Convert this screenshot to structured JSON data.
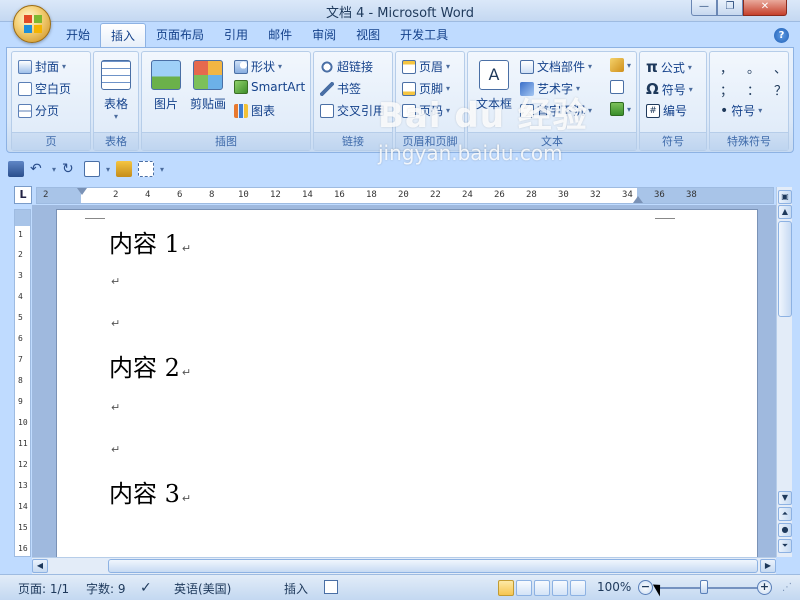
{
  "window": {
    "title": "文档 4 - Microsoft Word"
  },
  "tabs": [
    {
      "label": "开始"
    },
    {
      "label": "插入",
      "active": true
    },
    {
      "label": "页面布局"
    },
    {
      "label": "引用"
    },
    {
      "label": "邮件"
    },
    {
      "label": "审阅"
    },
    {
      "label": "视图"
    },
    {
      "label": "开发工具"
    }
  ],
  "ribbon": {
    "pages": {
      "label": "页",
      "cover": "封面",
      "blank": "空白页",
      "break": "分页"
    },
    "tables": {
      "label": "表格",
      "table": "表格"
    },
    "illustrations": {
      "label": "插图",
      "picture": "图片",
      "clipart": "剪贴画",
      "shapes": "形状",
      "smartart": "SmartArt",
      "chart": "图表"
    },
    "links": {
      "label": "链接",
      "hyperlink": "超链接",
      "bookmark": "书签",
      "crossref": "交叉引用"
    },
    "header_footer": {
      "label": "页眉和页脚",
      "header": "页眉",
      "footer": "页脚",
      "pagenum": "页码"
    },
    "text": {
      "label": "文本",
      "textbox": "文本框",
      "quickparts": "文档部件",
      "wordart": "艺术字",
      "dropcap": "首字下沉"
    },
    "symbols": {
      "label": "符号",
      "equation": "公式",
      "symbol": "符号",
      "number": "编号"
    },
    "special": {
      "label": "特殊符号",
      "row1": [
        "，",
        "。",
        "、"
      ],
      "row2": [
        "；",
        "：",
        "？"
      ],
      "symbol": "符号"
    }
  },
  "document": {
    "paragraphs": [
      {
        "text": "内容 1",
        "heading": true
      },
      {
        "text": "",
        "heading": false
      },
      {
        "text": "",
        "heading": false
      },
      {
        "text": "内容 2",
        "heading": true
      },
      {
        "text": "",
        "heading": false
      },
      {
        "text": "",
        "heading": false
      },
      {
        "text": "内容 3",
        "heading": true
      }
    ],
    "paragraph_mark": "↵"
  },
  "ruler": {
    "horizontal_ticks": [
      "2",
      "",
      "2",
      "4",
      "6",
      "8",
      "10",
      "12",
      "14",
      "16",
      "18",
      "20",
      "22",
      "24",
      "26",
      "28",
      "30",
      "32",
      "34",
      "36",
      "38"
    ],
    "vertical_ticks": [
      "1",
      "1",
      "2",
      "3",
      "4",
      "5",
      "6",
      "7",
      "8",
      "9",
      "10",
      "11",
      "12",
      "13",
      "14",
      "15",
      "16"
    ],
    "corner_label": "L"
  },
  "status": {
    "page": "页面: 1/1",
    "words": "字数: 9",
    "language": "英语(美国)",
    "mode": "插入",
    "zoom": "100%",
    "zoom_minus": "−",
    "zoom_plus": "+"
  },
  "watermark": {
    "logo": "Bai du 经验",
    "url": "jingyan.baidu.com"
  },
  "colors": {
    "ribbon_bg": "#dbe8f8",
    "text_accent": "#15428b",
    "page_bg": "#ffffff"
  }
}
